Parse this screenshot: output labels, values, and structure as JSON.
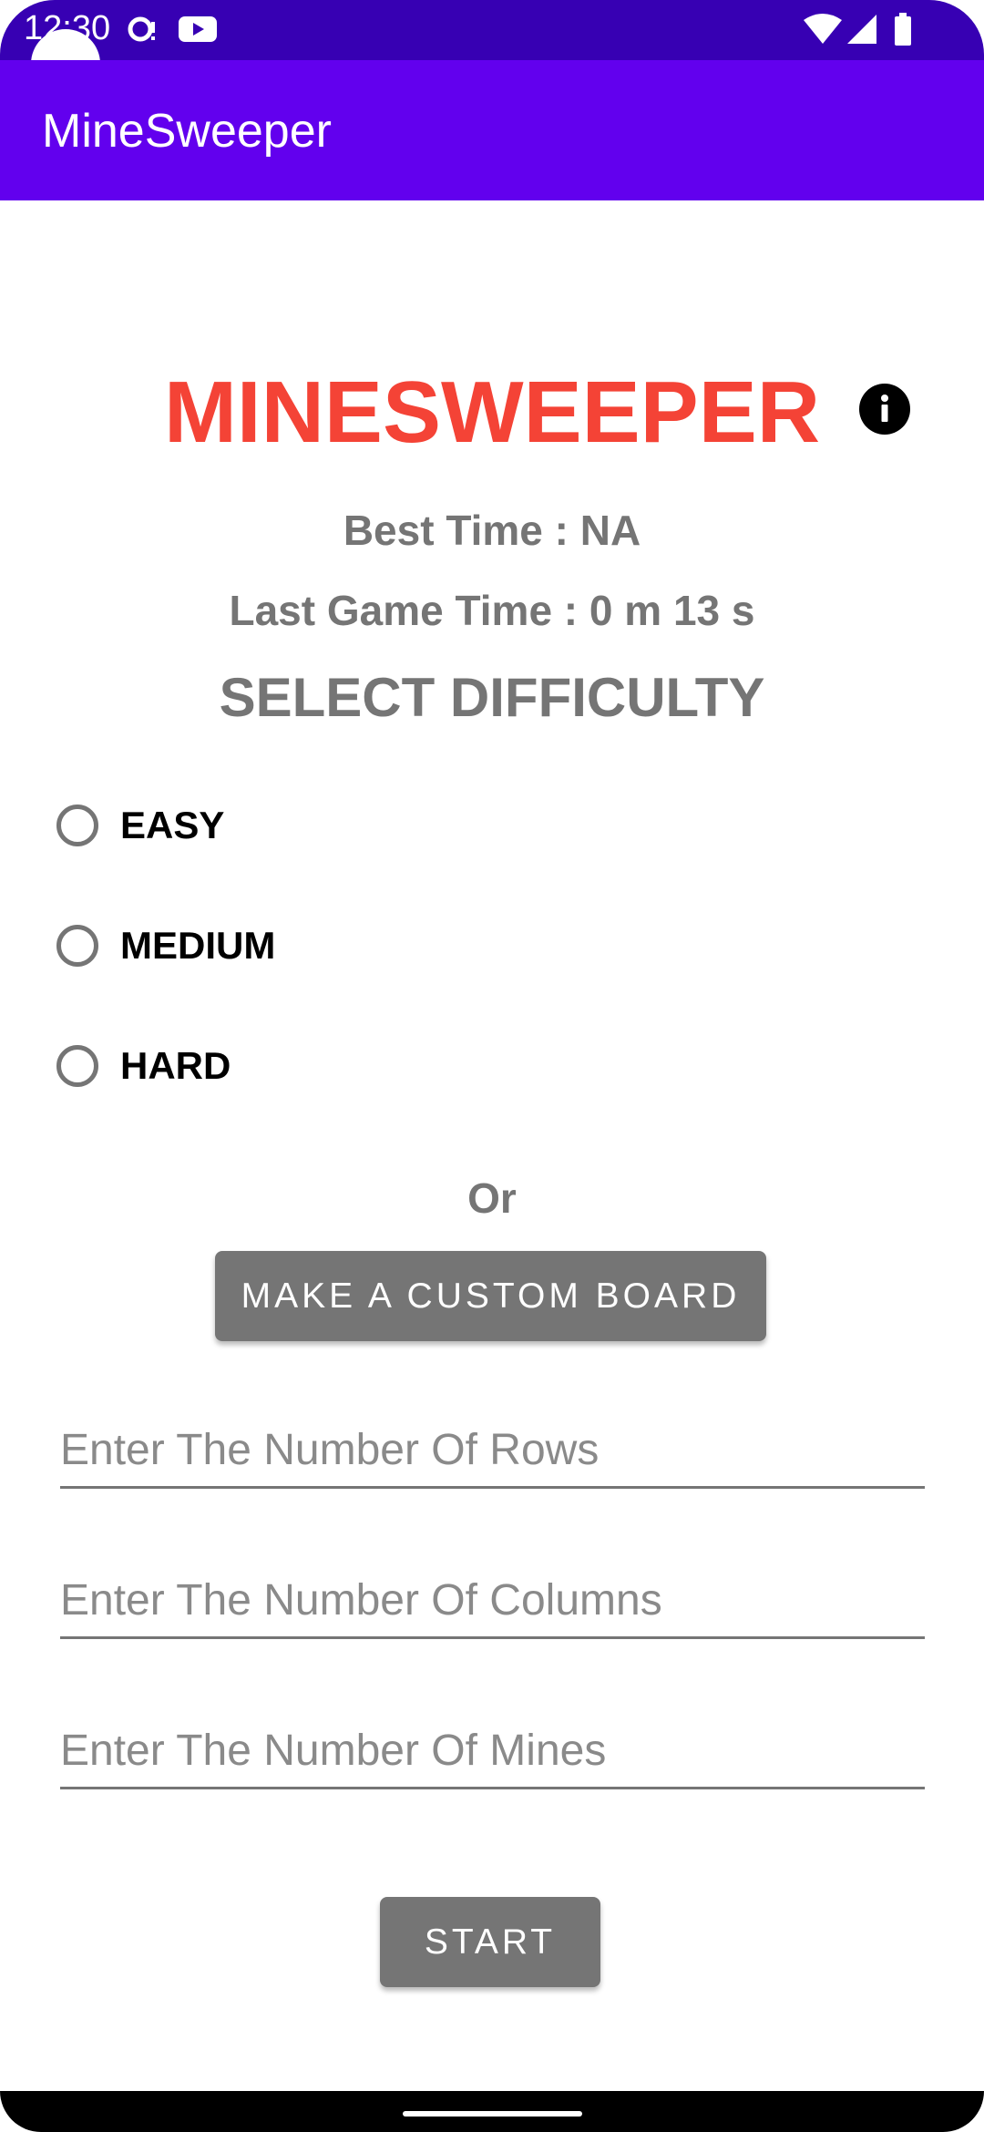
{
  "status_bar": {
    "time": "12:30",
    "icons": [
      "cast-icon",
      "youtube-icon",
      "wifi-icon",
      "signal-icon",
      "battery-icon"
    ]
  },
  "app_bar": {
    "title": "MineSweeper"
  },
  "main": {
    "title": "MINESWEEPER",
    "info_icon": "info-icon",
    "best_time": "Best Time :  NA",
    "last_game_time": "Last Game Time : 0 m 13 s",
    "difficulty_heading": "SELECT DIFFICULTY",
    "difficulties": [
      {
        "label": "EASY",
        "selected": false
      },
      {
        "label": "MEDIUM",
        "selected": false
      },
      {
        "label": "HARD",
        "selected": false
      }
    ],
    "or_text": "Or",
    "custom_board_button": "MAKE A CUSTOM BOARD",
    "fields": {
      "rows_placeholder": "Enter The Number Of Rows",
      "columns_placeholder": "Enter The Number Of Columns",
      "mines_placeholder": "Enter The Number Of Mines"
    },
    "start_button": "START"
  },
  "colors": {
    "status_bar": "#3700b3",
    "app_bar": "#6200ee",
    "title_red": "#f44336",
    "gray": "#757575"
  }
}
